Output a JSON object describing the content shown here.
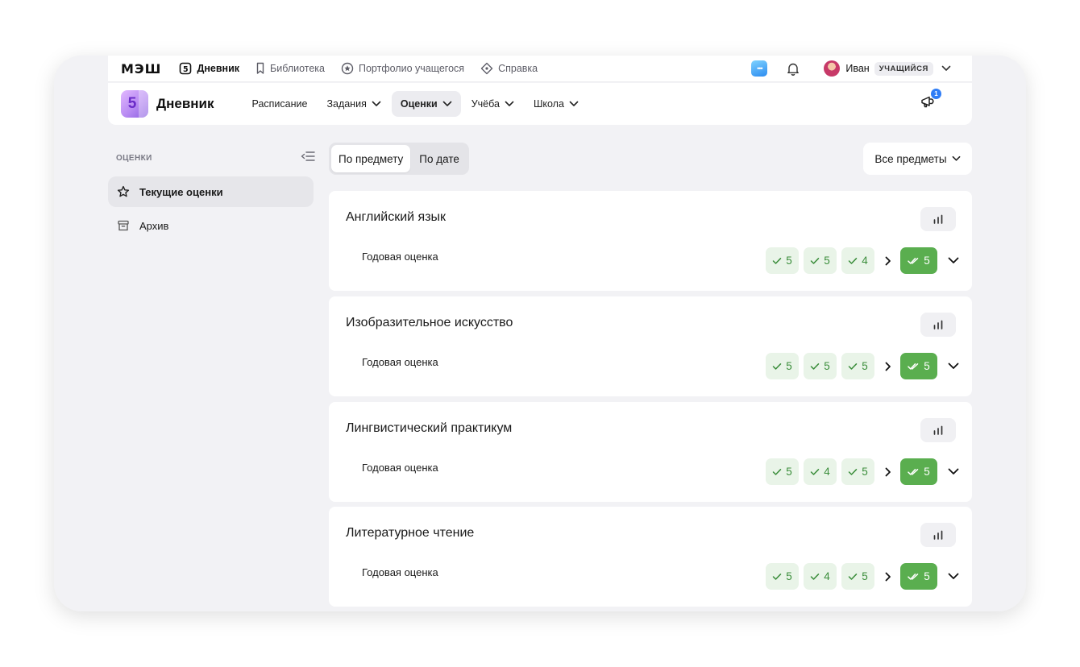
{
  "topbar": {
    "brand": "МЭШ",
    "links": [
      {
        "label": "Дневник",
        "icon": "diary-5-icon",
        "active": true
      },
      {
        "label": "Библиотека",
        "icon": "bookmark-icon",
        "active": false
      },
      {
        "label": "Портфолио учащегося",
        "icon": "star-badge-icon",
        "active": false
      },
      {
        "label": "Справка",
        "icon": "diamond-help-icon",
        "active": false
      }
    ],
    "chat_icon_text": "•••",
    "user": {
      "name": "Иван",
      "role": "УЧАЩИЙСЯ"
    }
  },
  "appbar": {
    "logo_text": "5",
    "title": "Дневник",
    "nav": [
      {
        "label": "Расписание",
        "has_dropdown": false,
        "active": false
      },
      {
        "label": "Задания",
        "has_dropdown": true,
        "active": false
      },
      {
        "label": "Оценки",
        "has_dropdown": true,
        "active": true
      },
      {
        "label": "Учёба",
        "has_dropdown": true,
        "active": false
      },
      {
        "label": "Школа",
        "has_dropdown": true,
        "active": false
      }
    ],
    "notification_count": "1"
  },
  "sidebar": {
    "heading": "ОЦЕНКИ",
    "items": [
      {
        "label": "Текущие оценки",
        "icon": "star-icon",
        "active": true
      },
      {
        "label": "Архив",
        "icon": "archive-box-icon",
        "active": false
      }
    ]
  },
  "view_toggle": {
    "options": [
      "По предмету",
      "По дате"
    ],
    "selected": "По предмету"
  },
  "subject_filter": {
    "label": "Все предметы"
  },
  "subjects": [
    {
      "name": "Английский язык",
      "row_label": "Годовая оценка",
      "marks": [
        "5",
        "5",
        "4"
      ],
      "final": "5"
    },
    {
      "name": "Изобразительное искусство",
      "row_label": "Годовая оценка",
      "marks": [
        "5",
        "5",
        "5"
      ],
      "final": "5"
    },
    {
      "name": "Лингвистический практикум",
      "row_label": "Годовая оценка",
      "marks": [
        "5",
        "4",
        "5"
      ],
      "final": "5"
    },
    {
      "name": "Литературное чтение",
      "row_label": "Годовая оценка",
      "marks": [
        "5",
        "4",
        "5"
      ],
      "final": "5"
    }
  ],
  "colors": {
    "page_bg": "#f2f2f5",
    "mark_bg": "#e9f4e8",
    "mark_text": "#3a8d3a",
    "final_mark_bg": "#5aae4f",
    "accent_blue": "#2f7df6",
    "logo_purple": "#b78af2"
  }
}
